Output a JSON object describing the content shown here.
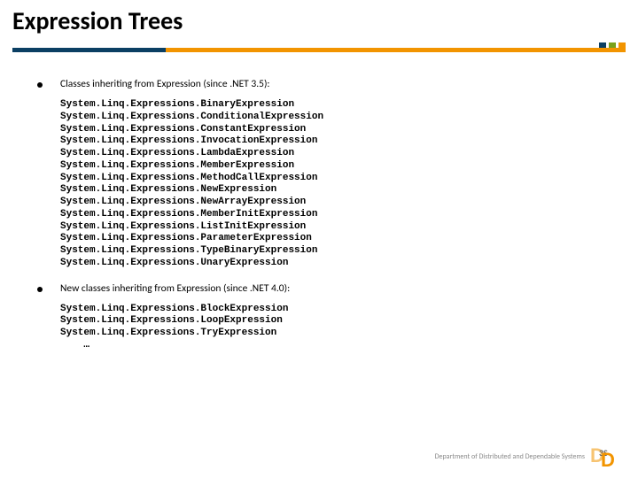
{
  "title": "Expression Trees",
  "bullets": [
    {
      "text": "Classes inheriting from Expression (since .NET 3.5):",
      "code": "System.Linq.Expressions.BinaryExpression\nSystem.Linq.Expressions.ConditionalExpression\nSystem.Linq.Expressions.ConstantExpression\nSystem.Linq.Expressions.InvocationExpression\nSystem.Linq.Expressions.LambdaExpression\nSystem.Linq.Expressions.MemberExpression\nSystem.Linq.Expressions.MethodCallExpression\nSystem.Linq.Expressions.NewExpression\nSystem.Linq.Expressions.NewArrayExpression\nSystem.Linq.Expressions.MemberInitExpression\nSystem.Linq.Expressions.ListInitExpression\nSystem.Linq.Expressions.ParameterExpression\nSystem.Linq.Expressions.TypeBinaryExpression\nSystem.Linq.Expressions.UnaryExpression"
    },
    {
      "text": "New classes inheriting from Expression (since .NET 4.0):",
      "code": "System.Linq.Expressions.BlockExpression\nSystem.Linq.Expressions.LoopExpression\nSystem.Linq.Expressions.TryExpression\n    …"
    }
  ],
  "footer": {
    "dept": "Department of\nDistributed and\nDependable\nSystems",
    "logo_text": "D",
    "logo_small": "3S"
  }
}
